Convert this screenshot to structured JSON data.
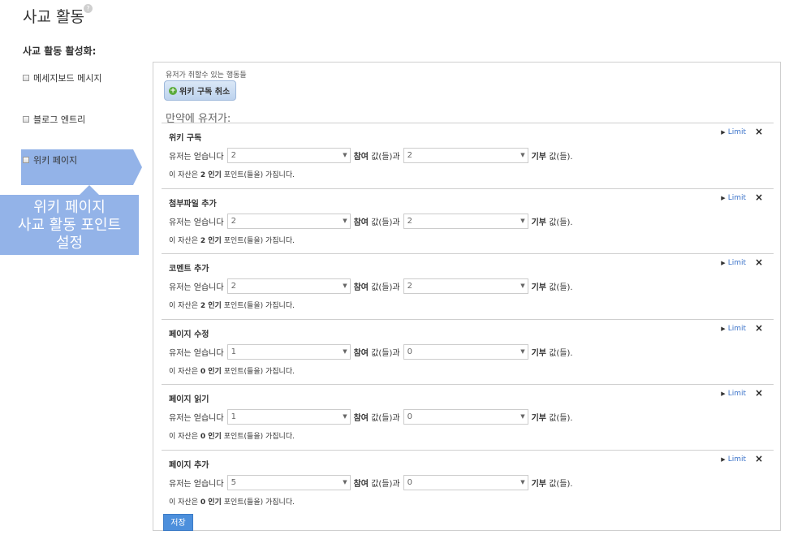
{
  "header": {
    "title": "사교 활동",
    "help_glyph": "?"
  },
  "sidebar": {
    "section_label": "사교 활동 활성화:",
    "items": [
      {
        "label": "메세지보드 메시지",
        "checked": false
      },
      {
        "label": "블로그 엔트리",
        "checked": false
      },
      {
        "label": "위키 페이지",
        "checked": false,
        "selected": true
      }
    ]
  },
  "callout": {
    "line1": "위키 페이지",
    "line2": "사교 활동 포인트",
    "line3": "설정",
    "color": "#93b3e8"
  },
  "panel": {
    "actions_label": "유저가 취할수 있는 행동들",
    "action_button": "위키 구독 취소",
    "if_user_label": "만약에 유저가:",
    "limit_label": "Limit",
    "close_glyph": "×",
    "rules": [
      {
        "title": "위키 구독",
        "prefix": "유저는 얻습니다",
        "participation": "2",
        "participation_label": "참여",
        "participation_suffix": "값(들)과",
        "contribution": "2",
        "contribution_label": "기부",
        "contribution_suffix": "값(들).",
        "note_prefix": "이 자산은",
        "popularity": "2 인기",
        "note_suffix": "포인트(들을) 가집니다."
      },
      {
        "title": "첨부파일 추가",
        "prefix": "유저는 얻습니다",
        "participation": "2",
        "participation_label": "참여",
        "participation_suffix": "값(들)과",
        "contribution": "2",
        "contribution_label": "기부",
        "contribution_suffix": "값(들).",
        "note_prefix": "이 자산은",
        "popularity": "2 인기",
        "note_suffix": "포인트(들을) 가집니다."
      },
      {
        "title": "코멘트 추가",
        "prefix": "유저는 얻습니다",
        "participation": "2",
        "participation_label": "참여",
        "participation_suffix": "값(들)과",
        "contribution": "2",
        "contribution_label": "기부",
        "contribution_suffix": "값(들).",
        "note_prefix": "이 자산은",
        "popularity": "2 인기",
        "note_suffix": "포인트(들을) 가집니다."
      },
      {
        "title": "페이지 수정",
        "prefix": "유저는 얻습니다",
        "participation": "1",
        "participation_label": "참여",
        "participation_suffix": "값(들)과",
        "contribution": "0",
        "contribution_label": "기부",
        "contribution_suffix": "값(들).",
        "note_prefix": "이 자산은",
        "popularity": "0 인기",
        "note_suffix": "포인트(들을) 가집니다."
      },
      {
        "title": "페이지 읽기",
        "prefix": "유저는 얻습니다",
        "participation": "1",
        "participation_label": "참여",
        "participation_suffix": "값(들)과",
        "contribution": "0",
        "contribution_label": "기부",
        "contribution_suffix": "값(들).",
        "note_prefix": "이 자산은",
        "popularity": "0 인기",
        "note_suffix": "포인트(들을) 가집니다."
      },
      {
        "title": "페이지 추가",
        "prefix": "유저는 얻습니다",
        "participation": "5",
        "participation_label": "참여",
        "participation_suffix": "값(들)과",
        "contribution": "0",
        "contribution_label": "기부",
        "contribution_suffix": "값(들).",
        "note_prefix": "이 자산은",
        "popularity": "0 인기",
        "note_suffix": "포인트(들을) 가집니다."
      }
    ],
    "save_label": "저장"
  }
}
